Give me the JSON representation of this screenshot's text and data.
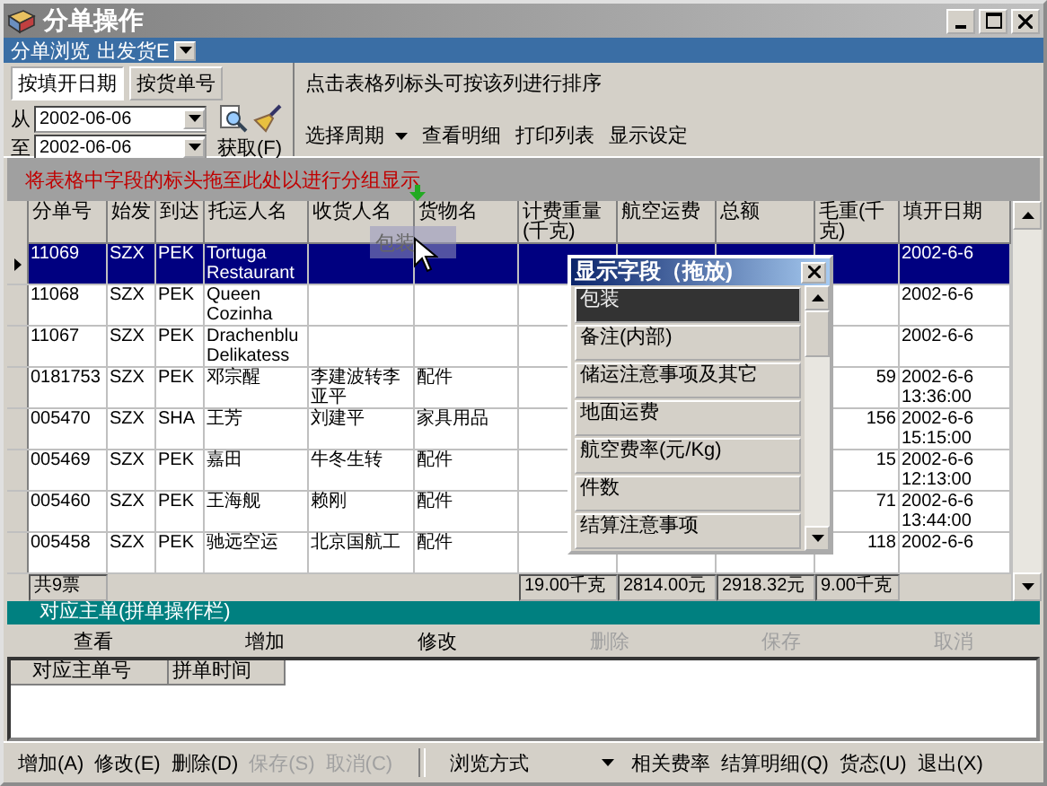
{
  "window": {
    "title": "分单操作"
  },
  "view_bar": {
    "label": "分单浏览",
    "dropdown": "出发货E"
  },
  "tabs": [
    {
      "label": "按填开日期",
      "selected": true
    },
    {
      "label": "按货单号",
      "selected": false
    }
  ],
  "date_from": {
    "label": "从",
    "value": "2002-06-06"
  },
  "date_to": {
    "label": "至",
    "value": "2002-06-06"
  },
  "fetch_button": "获取(F)",
  "sort_hint": "点击表格列标头可按该列进行排序",
  "menu": [
    {
      "label": "选择周期",
      "kind": "dropdown"
    },
    {
      "label": "查看明细",
      "kind": "item"
    },
    {
      "label": "打印列表",
      "kind": "item"
    },
    {
      "label": "显示设定",
      "kind": "item"
    }
  ],
  "group_hint": "将表格中字段的标头拖至此处以进行分组显示",
  "table": {
    "columns": [
      "分单号",
      "始发",
      "到达",
      "托运人名",
      "收货人名",
      "货物名",
      "计费重量(千克)",
      "航空运费",
      "总额",
      "毛重(千克)",
      "填开日期"
    ],
    "rows": [
      {
        "selected": true,
        "cells": [
          "11069",
          "SZX",
          "PEK",
          "Tortuga Restaurant",
          null,
          null,
          null,
          null,
          null,
          null,
          "2002-6-6"
        ]
      },
      {
        "selected": false,
        "cells": [
          "11068",
          "SZX",
          "PEK",
          "Queen Cozinha",
          null,
          null,
          null,
          null,
          null,
          null,
          "2002-6-6"
        ]
      },
      {
        "selected": false,
        "cells": [
          "11067",
          "SZX",
          "PEK",
          "Drachenblu Delikatess",
          null,
          null,
          null,
          null,
          null,
          null,
          "2002-6-6"
        ]
      },
      {
        "selected": false,
        "cells": [
          "0181753",
          "SZX",
          "PEK",
          "邓宗醒",
          "李建波转李亚平",
          "配件",
          null,
          null,
          null,
          "59",
          "2002-6-6 13:36:00"
        ]
      },
      {
        "selected": false,
        "cells": [
          "005470",
          "SZX",
          "SHA",
          "王芳",
          "刘建平",
          "家具用品",
          null,
          null,
          null,
          "156",
          "2002-6-6 15:15:00"
        ]
      },
      {
        "selected": false,
        "cells": [
          "005469",
          "SZX",
          "PEK",
          "嘉田",
          "牛冬生转",
          "配件",
          null,
          null,
          null,
          "15",
          "2002-6-6 12:13:00"
        ]
      },
      {
        "selected": false,
        "cells": [
          "005460",
          "SZX",
          "PEK",
          "王海舰",
          "赖刚",
          "配件",
          null,
          null,
          null,
          "71",
          "2002-6-6 13:44:00"
        ]
      },
      {
        "selected": false,
        "cells": [
          "005458",
          "SZX",
          "PEK",
          "驰远空运",
          "北京国航工",
          "配件",
          null,
          null,
          null,
          "118",
          "2002-6-6"
        ]
      }
    ],
    "footer": {
      "count": "共9票",
      "totals": [
        "19.00千克",
        "2814.00元",
        "2918.32元",
        "9.00千克"
      ]
    }
  },
  "drag_ghost": "包装",
  "field_popup": {
    "title": "显示字段（拖放)",
    "items": [
      {
        "label": "包装",
        "selected": true
      },
      {
        "label": "备注(内部)",
        "selected": false
      },
      {
        "label": "储运注意事项及其它",
        "selected": false
      },
      {
        "label": "地面运费",
        "selected": false
      },
      {
        "label": "航空费率(元/Kg)",
        "selected": false
      },
      {
        "label": "件数",
        "selected": false
      },
      {
        "label": "结算注意事项",
        "selected": false
      }
    ]
  },
  "sub_panel": {
    "title": "对应主单(拼单操作栏)",
    "buttons": [
      {
        "label": "查看",
        "disabled": false
      },
      {
        "label": "增加",
        "disabled": false
      },
      {
        "label": "修改",
        "disabled": false
      },
      {
        "label": "删除",
        "disabled": true
      },
      {
        "label": "保存",
        "disabled": true
      },
      {
        "label": "取消",
        "disabled": true
      }
    ],
    "columns": [
      "对应主单号",
      "拼单时间"
    ]
  },
  "bottom_toolbar": [
    {
      "label": "增加(A)",
      "kind": "button",
      "disabled": false
    },
    {
      "label": "修改(E)",
      "kind": "button",
      "disabled": false
    },
    {
      "label": "删除(D)",
      "kind": "button",
      "disabled": false
    },
    {
      "label": "保存(S)",
      "kind": "button",
      "disabled": true
    },
    {
      "label": "取消(C)",
      "kind": "button",
      "disabled": true
    },
    {
      "label": "浏览方式",
      "kind": "dropdown"
    },
    {
      "label": "相关费率",
      "kind": "button",
      "disabled": false
    },
    {
      "label": "结算明细(Q)",
      "kind": "button",
      "disabled": false
    },
    {
      "label": "货态(U)",
      "kind": "button",
      "disabled": false
    },
    {
      "label": "退出(X)",
      "kind": "button",
      "disabled": false
    }
  ]
}
